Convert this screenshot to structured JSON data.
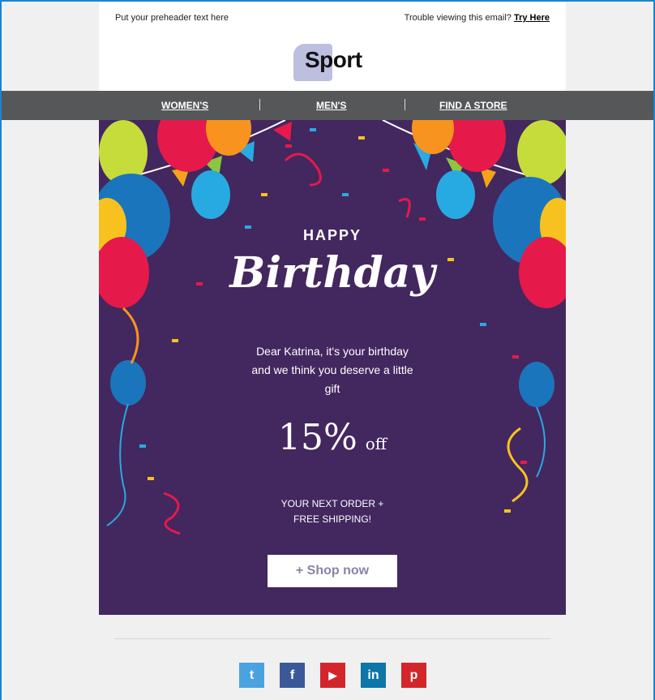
{
  "preheader": {
    "text": "Put your preheader text here",
    "trouble_text": "Trouble viewing this email?",
    "try_here": "Try Here"
  },
  "logo": {
    "text": "Sport"
  },
  "nav": {
    "items": [
      "WOMEN'S",
      "MEN'S",
      "FIND A STORE"
    ]
  },
  "hero": {
    "happy": "HAPPY",
    "birthday": "Birthday",
    "message": "Dear Katrina, it's your birthday and we think you deserve a little gift",
    "offer_number": "15%",
    "offer_off": "off",
    "next_line1": "YOUR NEXT ORDER +",
    "next_line2": "FREE SHIPPING!",
    "button": "+ Shop now"
  },
  "social": [
    {
      "name": "twitter",
      "glyph": "t",
      "color": "#4aa3e0"
    },
    {
      "name": "facebook",
      "glyph": "f",
      "color": "#3b5998"
    },
    {
      "name": "youtube",
      "glyph": "▶",
      "color": "#d3262b"
    },
    {
      "name": "linkedin",
      "glyph": "in",
      "color": "#0e76a8"
    },
    {
      "name": "pinterest",
      "glyph": "p",
      "color": "#d3262b"
    }
  ],
  "colors": {
    "hero_bg": "#43275f",
    "nav_bg": "#555759",
    "frame_border": "#1a84d6"
  }
}
